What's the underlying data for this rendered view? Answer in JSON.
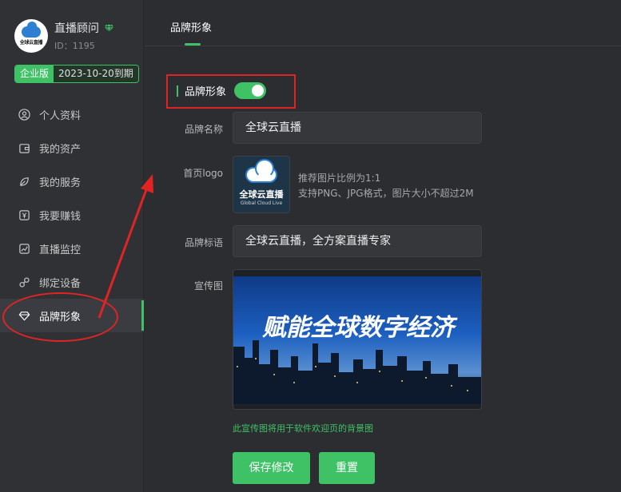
{
  "profile": {
    "avatar_text": "全球云直播",
    "name": "直播顾问",
    "id_text": "ID：1195",
    "vip_icon": "diamond-icon"
  },
  "plan": {
    "tier": "企业版",
    "expire": "2023-10-20到期"
  },
  "menu": {
    "items": [
      {
        "label": "个人资料",
        "icon": "user-icon"
      },
      {
        "label": "我的资产",
        "icon": "wallet-icon"
      },
      {
        "label": "我的服务",
        "icon": "leaf-icon"
      },
      {
        "label": "我要赚钱",
        "icon": "money-icon"
      },
      {
        "label": "直播监控",
        "icon": "chart-icon"
      },
      {
        "label": "绑定设备",
        "icon": "link-icon"
      },
      {
        "label": "品牌形象",
        "icon": "diamond-icon",
        "active": true
      }
    ]
  },
  "header": {
    "tab": "品牌形象"
  },
  "form": {
    "toggle_label": "品牌形象",
    "toggle_on": true,
    "brand_name_label": "品牌名称",
    "brand_name_value": "全球云直播",
    "logo_label": "首页logo",
    "logo_text": "全球云直播",
    "logo_sub": "Global Cloud Live",
    "logo_hint_1": "推荐图片比例为1:1",
    "logo_hint_2": "支持PNG、JPG格式，图片大小不超过2M",
    "slogan_label": "品牌标语",
    "slogan_value": "全球云直播，全方案直播专家",
    "promo_label": "宣传图",
    "promo_text": "赋能全球数字经济",
    "promo_note": "此宣传图将用于软件欢迎页的背景图"
  },
  "buttons": {
    "save": "保存修改",
    "reset": "重置"
  },
  "colors": {
    "accent": "#3fc266",
    "background": "#2b2d31",
    "annotation": "#e02424"
  }
}
